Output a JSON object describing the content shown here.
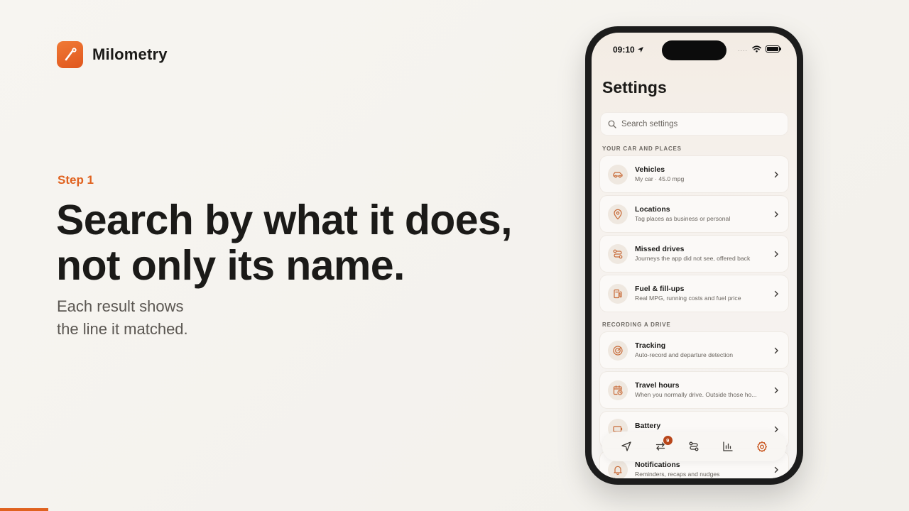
{
  "brand": {
    "name": "Milometry",
    "logo_icon": "pen-mark-icon"
  },
  "hero": {
    "step": "Step 1",
    "headline_line1": "Search by what it does,",
    "headline_line2": "not only its name.",
    "sub_line1": "Each result shows",
    "sub_line2": "the line it matched."
  },
  "colors": {
    "accent": "#e0621f",
    "icon": "#c86a37",
    "text": "#1b1a18",
    "muted": "#6a655f"
  },
  "phone": {
    "status": {
      "time": "09:10",
      "signal": "....",
      "wifi_icon": "wifi-icon",
      "battery_icon": "battery-icon"
    },
    "title": "Settings",
    "search": {
      "placeholder": "Search settings",
      "value": ""
    },
    "sections": [
      {
        "header": "YOUR CAR AND PLACES"
      },
      {
        "header": "RECORDING A DRIVE"
      }
    ],
    "rows": [
      {
        "title": "Vehicles",
        "subtitle": "My car · 45.0 mpg",
        "icon": "car-icon"
      },
      {
        "title": "Locations",
        "subtitle": "Tag places as business or personal",
        "icon": "location-pin-icon"
      },
      {
        "title": "Missed drives",
        "subtitle": "Journeys the app did not see, offered back",
        "icon": "route-icon"
      },
      {
        "title": "Fuel & fill-ups",
        "subtitle": "Real MPG, running costs and fuel price",
        "icon": "fuel-pump-icon"
      },
      {
        "title": "Tracking",
        "subtitle": "Auto-record and departure detection",
        "icon": "radar-icon"
      },
      {
        "title": "Travel hours",
        "subtitle": "When you normally drive. Outside those ho...",
        "icon": "calendar-clock-icon"
      },
      {
        "title": "Battery",
        "subtitle": "",
        "icon": "battery-charge-icon"
      },
      {
        "title": "Notifications",
        "subtitle": "Reminders, recaps and nudges",
        "icon": "bell-icon"
      }
    ],
    "tabs": [
      {
        "name": "drive",
        "icon": "navigation-arrow-icon",
        "active": false
      },
      {
        "name": "trips",
        "icon": "swap-arrows-icon",
        "badge": "9",
        "active": false
      },
      {
        "name": "routes",
        "icon": "route-icon",
        "active": false
      },
      {
        "name": "reports",
        "icon": "bar-chart-icon",
        "active": false
      },
      {
        "name": "settings",
        "icon": "gear-icon",
        "active": true
      }
    ]
  }
}
